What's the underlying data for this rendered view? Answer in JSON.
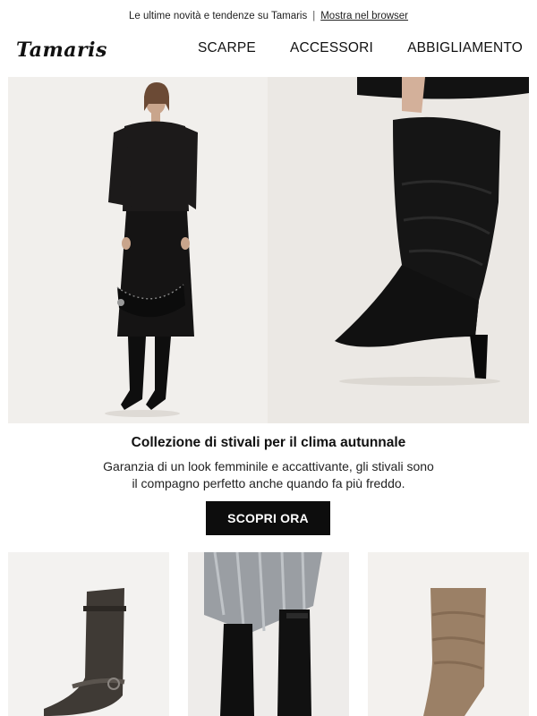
{
  "preheader": {
    "text": "Le ultime novità e tendenze su Tamaris",
    "separator": "|",
    "browser_link": "Mostra nel browser"
  },
  "header": {
    "logo_text": "Tamaris",
    "nav": [
      "SCARPE",
      "ACCESSORI",
      "ABBIGLIAMENTO"
    ]
  },
  "hero": {
    "left_image": "model-in-black-outfit-with-boots",
    "right_image": "black-suede-slouch-boot-closeup"
  },
  "content": {
    "headline": "Collezione di stivali per il clima autunnale",
    "subtext_line1": "Garanzia di un look femminile e accattivante, gli stivali sono",
    "subtext_line2": "il compagno perfetto anche quando fa più freddo.",
    "cta_label": "SCOPRI ORA"
  },
  "products": [
    {
      "image": "grey-leather-boot-with-buckle-strap"
    },
    {
      "image": "black-leather-biker-boots-with-pleated-skirt"
    },
    {
      "image": "taupe-slouch-heeled-boot"
    }
  ],
  "colors": {
    "cta_bg": "#0d0d0d",
    "cta_text": "#ffffff",
    "text": "#111111"
  }
}
